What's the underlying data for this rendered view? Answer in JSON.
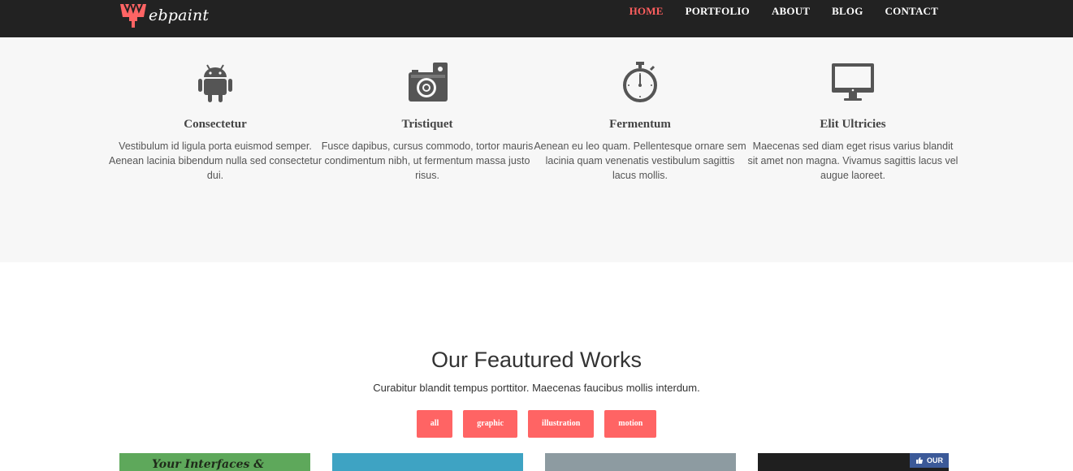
{
  "brand": {
    "logo_text": "ebpaint",
    "accent": "#ff5f5f"
  },
  "nav": {
    "items": [
      "HOME",
      "PORTFOLIO",
      "ABOUT",
      "BLOG",
      "CONTACT"
    ],
    "active": "HOME"
  },
  "features": [
    {
      "icon": "android-icon",
      "title": "Consectetur",
      "text": "Vestibulum id ligula porta euismod semper. Aenean lacinia bibendum nulla sed consectetur dui."
    },
    {
      "icon": "camera-icon",
      "title": "Tristiquet",
      "text": "Fusce dapibus, cursus commodo, tortor mauris condimentum nibh, ut fermentum massa justo risus."
    },
    {
      "icon": "stopwatch-icon",
      "title": "Fermentum",
      "text": "Aenean eu leo quam. Pellentesque ornare sem lacinia quam venenatis vestibulum sagittis lacus mollis."
    },
    {
      "icon": "monitor-icon",
      "title": "Elit Ultricies",
      "text": "Maecenas sed diam eget risus varius blandit sit amet non magna. Vivamus sagittis lacus vel augue laoreet."
    }
  ],
  "works": {
    "title": "Our Feautured Works",
    "subtitle": "Curabitur blandit tempus porttitor. Maecenas faucibus mollis interdum.",
    "filters": [
      "all",
      "graphic",
      "illustration",
      "motion"
    ],
    "thumb1_text": "Your Interfaces & Design",
    "fb_badge": "OUR"
  }
}
